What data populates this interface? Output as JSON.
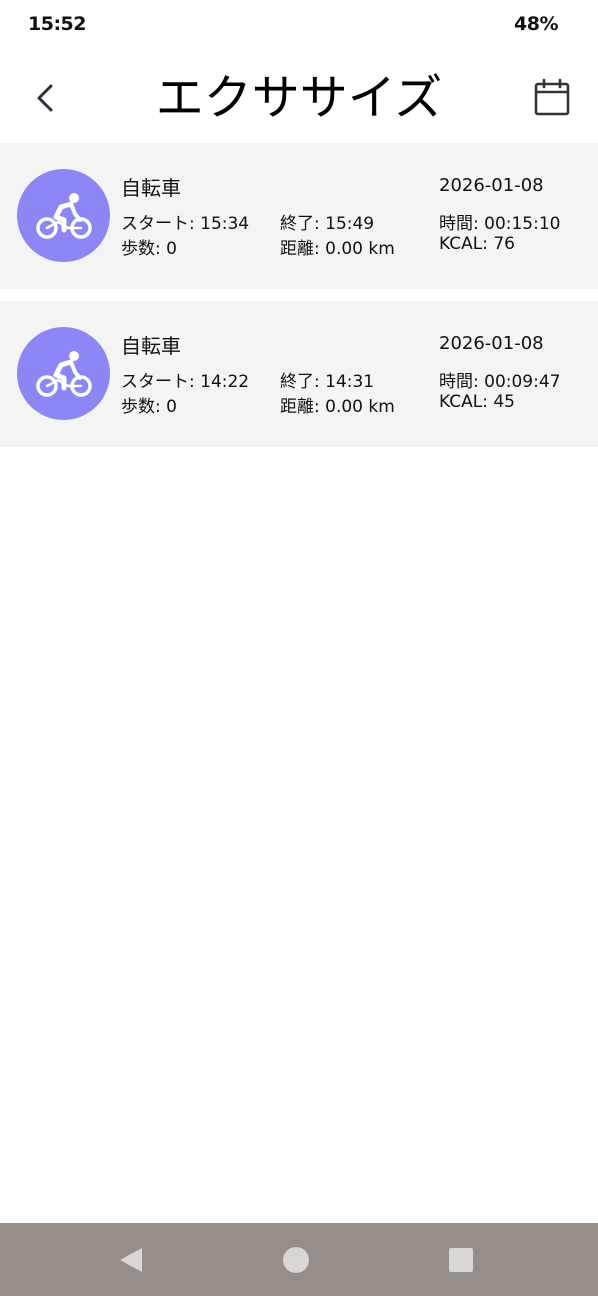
{
  "status_bar": {
    "time": "15:52",
    "battery": "48%"
  },
  "header": {
    "title": "エクササイズ",
    "back_icon": "chevron-left-icon",
    "calendar_icon": "calendar-icon"
  },
  "records": [
    {
      "activity": "自転車",
      "icon": "bicycle-icon",
      "date": "2026-01-08",
      "start": "スタート: 15:34",
      "end": "終了: 15:49",
      "duration": "時間: 00:15:10",
      "steps": "歩数: 0",
      "distance": "距離: 0.00 km",
      "kcal": "KCAL: 76"
    },
    {
      "activity": "自転車",
      "icon": "bicycle-icon",
      "date": "2026-01-08",
      "start": "スタート: 14:22",
      "end": "終了: 14:31",
      "duration": "時間: 00:09:47",
      "steps": "歩数: 0",
      "distance": "距離: 0.00 km",
      "kcal": "KCAL: 45"
    }
  ],
  "colors": {
    "avatar_bg": "#8d86f6",
    "card_bg": "#f4f4f4",
    "nav_bar_bg": "#958e88",
    "nav_icon": "#d9d6d3"
  },
  "nav_bar": {
    "back_icon": "triangle-back-icon",
    "home_icon": "circle-home-icon",
    "recents_icon": "square-recents-icon"
  }
}
